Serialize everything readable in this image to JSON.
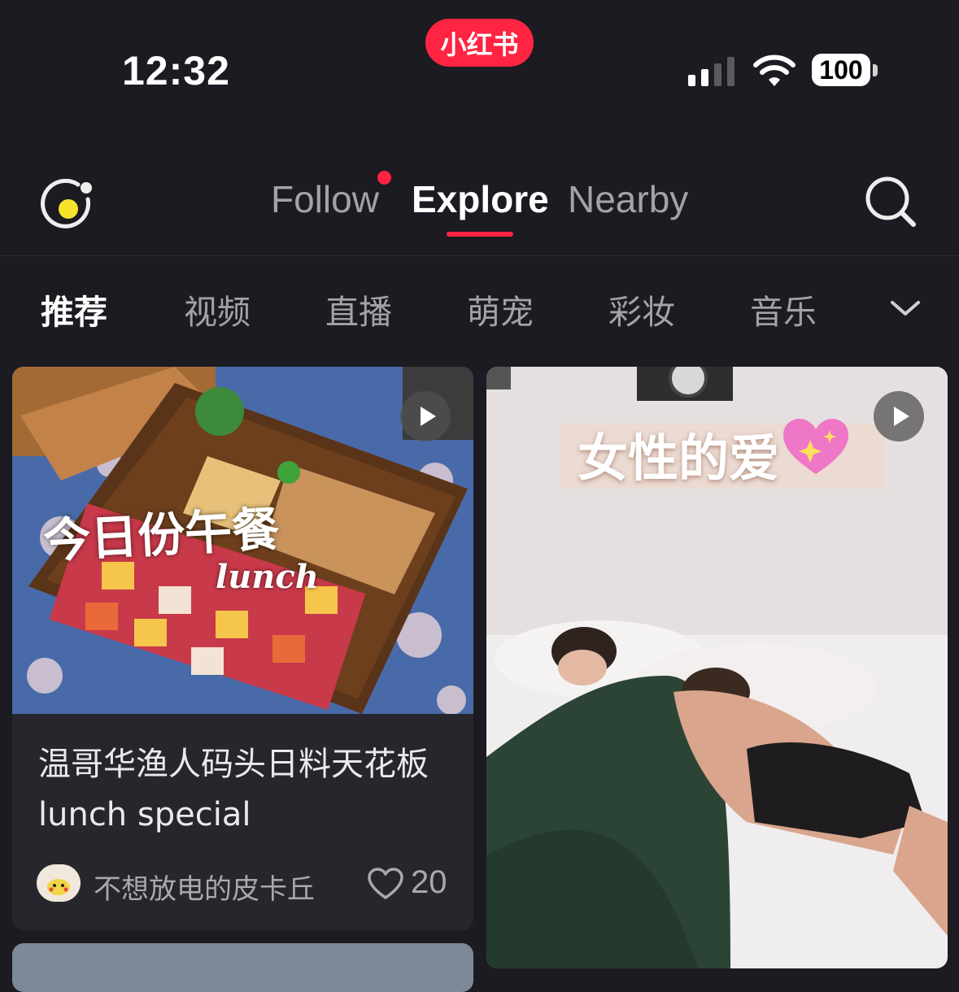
{
  "status_bar": {
    "time": "12:32",
    "app_badge": "小红书",
    "battery_level": "100",
    "icons": [
      "signal-icon",
      "wifi-icon",
      "battery-icon"
    ]
  },
  "nav": {
    "tabs": [
      {
        "label": "Follow",
        "has_dot": true
      },
      {
        "label": "Explore",
        "active": true
      },
      {
        "label": "Nearby"
      }
    ],
    "left_icon": "capture-icon",
    "right_icon": "search-icon"
  },
  "channels": {
    "items": [
      "推荐",
      "视频",
      "直播",
      "萌宠",
      "彩妆",
      "音乐"
    ],
    "active_index": 0,
    "more_icon": "chevron-down-icon"
  },
  "feed": {
    "cards": [
      {
        "overlay_title": "今日份午餐",
        "overlay_subtitle": "lunch",
        "is_video": true,
        "title": "温哥华渔人码头日料天花板lunch special",
        "author": "不想放电的皮卡丘",
        "likes": "20"
      },
      {
        "overlay_title": "女性的爱",
        "is_video": true
      }
    ]
  },
  "colors": {
    "accent": "#ff2442",
    "background": "#1b1b21",
    "card": "#26262c",
    "muted_text": "#a2a2a8"
  }
}
